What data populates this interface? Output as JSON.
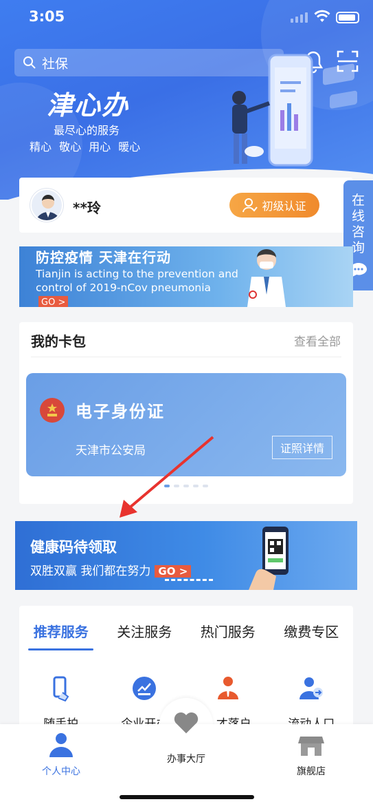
{
  "status": {
    "time": "3:05"
  },
  "search": {
    "value": "社保"
  },
  "hero": {
    "logo": "津心办",
    "slogan": "最尽心的服务",
    "subslogan": "精心 敬心 用心 暖心"
  },
  "user": {
    "name": "**玲",
    "cert_label": "初级认证"
  },
  "consult": {
    "label": "在线咨询"
  },
  "epidemic_banner": {
    "title": "防控疫情 天津在行动",
    "english": "Tianjin is acting to the prevention and control of 2019-nCov pneumonia",
    "go": "GO >"
  },
  "card_pack": {
    "title": "我的卡包",
    "view_all": "查看全部",
    "card": {
      "title": "电子身份证",
      "org": "天津市公安局",
      "detail_button": "证照详情"
    }
  },
  "health_banner": {
    "title": "健康码待领取",
    "subtitle": "双胜双赢 我们都在努力",
    "go": "GO >"
  },
  "services": {
    "tabs": [
      "推荐服务",
      "关注服务",
      "热门服务",
      "缴费专区"
    ],
    "items": [
      {
        "label": "随手拍",
        "icon": "phone-hand-icon"
      },
      {
        "label": "企业开办",
        "icon": "sign-badge-icon"
      },
      {
        "label": "人才落户",
        "icon": "person-tie-icon"
      },
      {
        "label": "流动人口",
        "icon": "person-move-icon"
      }
    ]
  },
  "nav": {
    "items": [
      {
        "label": "个人中心",
        "icon": "user-icon"
      },
      {
        "label": "办事大厅",
        "icon": "heart-icon"
      },
      {
        "label": "旗舰店",
        "icon": "store-icon"
      }
    ]
  },
  "colors": {
    "primary": "#3a72e0",
    "orange": "#f08a2c",
    "go_red": "#e85b3f",
    "arrow_red": "#e8332e"
  }
}
